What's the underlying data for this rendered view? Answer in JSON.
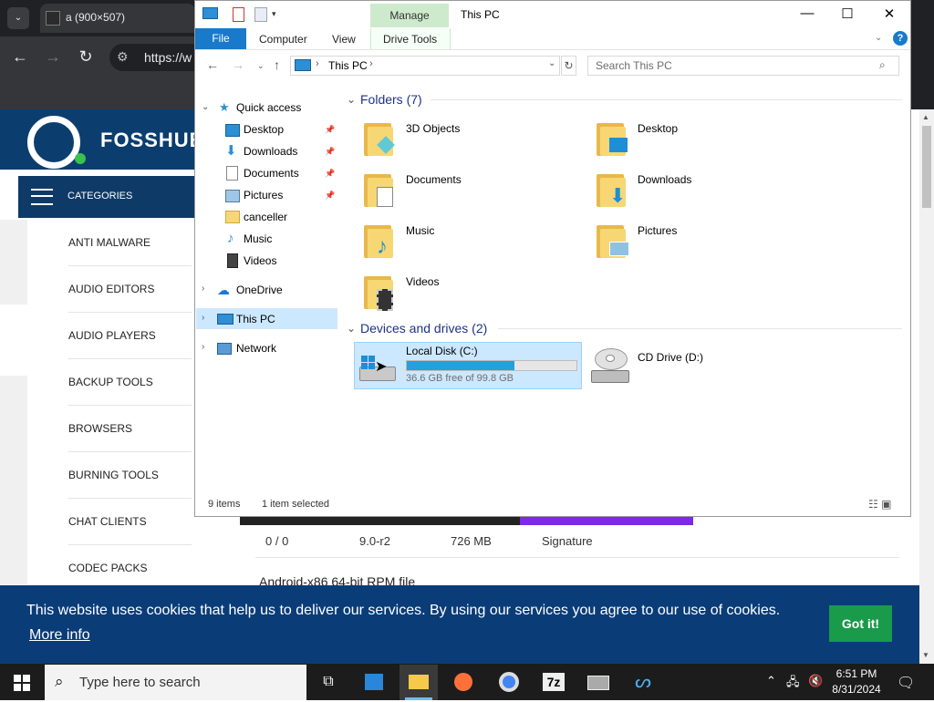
{
  "browser": {
    "tab_title": "a (900×507)",
    "url": "https://w",
    "tab_dropdown": "⌄"
  },
  "site": {
    "logo_text": "FOSSHUB",
    "categories_label": "CATEGORIES",
    "categories": [
      "ANTI MALWARE",
      "AUDIO EDITORS",
      "AUDIO PLAYERS",
      "BACKUP TOOLS",
      "BROWSERS",
      "BURNING TOOLS",
      "CHAT CLIENTS",
      "CODEC PACKS"
    ],
    "download_row": {
      "col1": "0 / 0",
      "col2": "9.0-r2",
      "col3": "726 MB",
      "col4": "Signature"
    },
    "android_text": "Android-x86 64-bit RPM file",
    "cookie": {
      "text": "This website uses cookies that help us to deliver our services. By using our services you agree to our use of cookies.",
      "more": "More info",
      "button": "Got it!"
    }
  },
  "explorer": {
    "title": "This PC",
    "manage_tab": "Manage",
    "ribbon": {
      "file": "File",
      "computer": "Computer",
      "view": "View",
      "drive_tools": "Drive Tools"
    },
    "address": "This PC",
    "search_placeholder": "Search This PC",
    "nav": {
      "quick_access": "Quick access",
      "items": [
        "Desktop",
        "Downloads",
        "Documents",
        "Pictures",
        "canceller",
        "Music",
        "Videos"
      ],
      "onedrive": "OneDrive",
      "this_pc": "This PC",
      "network": "Network"
    },
    "folders_header": "Folders (7)",
    "folders": [
      "3D Objects",
      "Desktop",
      "Documents",
      "Downloads",
      "Music",
      "Pictures",
      "Videos"
    ],
    "devices_header": "Devices and drives (2)",
    "drive_c": {
      "label": "Local Disk (C:)",
      "free": "36.6 GB free of 99.8 GB",
      "used_fraction": 0.633
    },
    "drive_d": {
      "label": "CD Drive (D:)"
    },
    "status": {
      "items": "9 items",
      "selected": "1 item selected"
    }
  },
  "taskbar": {
    "search_text": "Type here to search",
    "time": "6:51 PM",
    "date": "8/31/2024"
  }
}
